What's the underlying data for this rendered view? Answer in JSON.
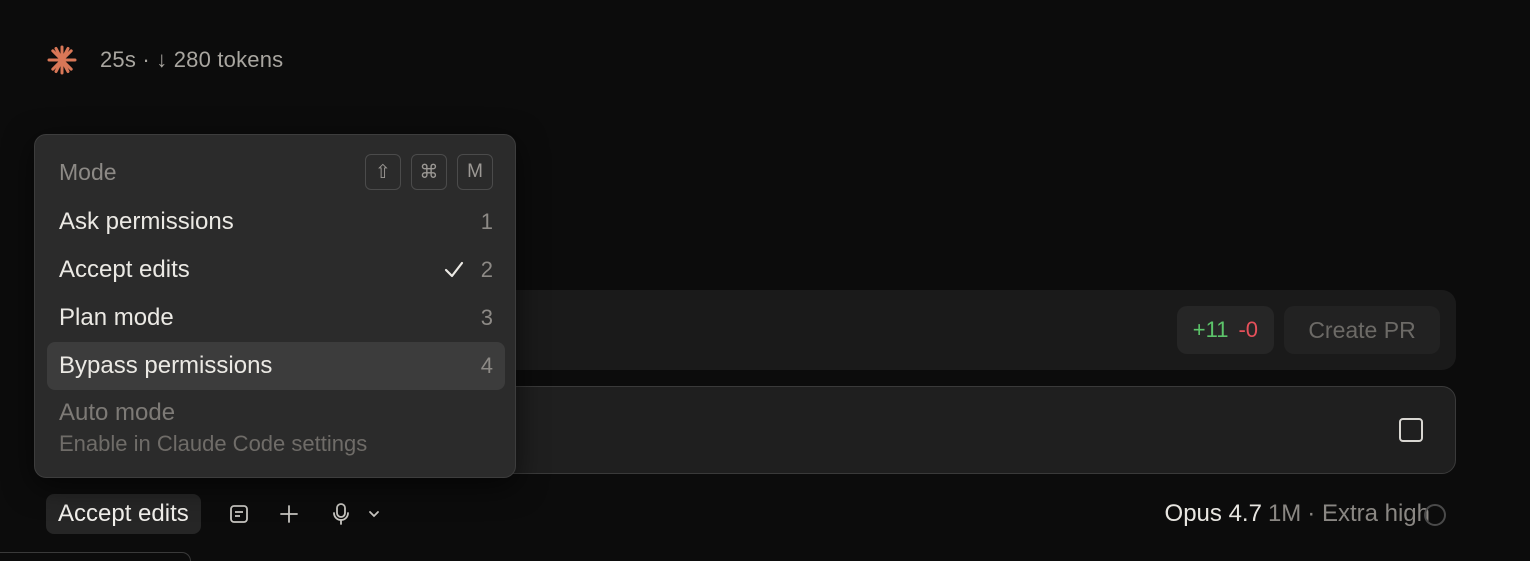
{
  "status": {
    "icon": "spark-icon",
    "text": "25s · ↓ 280 tokens"
  },
  "diff": {
    "added": "+11",
    "removed": "-0"
  },
  "create_pr_label": "Create PR",
  "menu": {
    "title": "Mode",
    "shortcut_keys": [
      "⇧",
      "⌘",
      "M"
    ],
    "items": [
      {
        "label": "Ask permissions",
        "number": "1",
        "checked": false
      },
      {
        "label": "Accept edits",
        "number": "2",
        "checked": true
      },
      {
        "label": "Plan mode",
        "number": "3",
        "checked": false
      },
      {
        "label": "Bypass permissions",
        "number": "4",
        "checked": false
      }
    ],
    "disabled_item": {
      "label": "Auto mode",
      "sub": "Enable in Claude Code settings"
    }
  },
  "bottom": {
    "mode_label": "Accept edits",
    "model_name": "Opus 4.7",
    "model_ctx": "1M",
    "model_effort": "· Extra high"
  },
  "colors": {
    "accent": "#d97757",
    "added": "#5cc46a",
    "removed": "#e5505a"
  }
}
